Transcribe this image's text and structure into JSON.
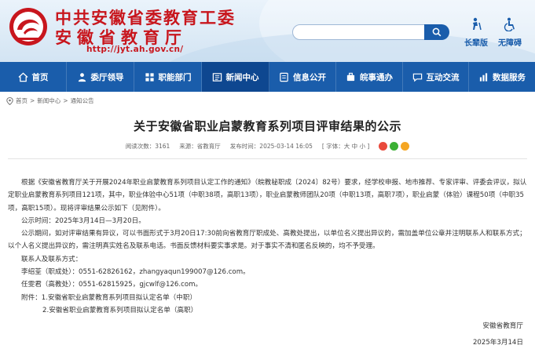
{
  "site": {
    "title_line1": "中共安徽省委教育工委",
    "title_line2": "安徽省教育厅",
    "url": "http://jyt.ah.gov.cn/",
    "tools": [
      {
        "label": "长辈版",
        "icon": "elder-mode-icon"
      },
      {
        "label": "无障碍",
        "icon": "accessibility-icon"
      }
    ]
  },
  "nav": {
    "items": [
      {
        "label": "首页",
        "icon": "home-icon"
      },
      {
        "label": "委厅领导",
        "icon": "leaders-icon"
      },
      {
        "label": "职能部门",
        "icon": "departments-icon"
      },
      {
        "label": "新闻中心",
        "icon": "news-icon",
        "active": true
      },
      {
        "label": "信息公开",
        "icon": "info-icon"
      },
      {
        "label": "皖事通办",
        "icon": "service-icon"
      },
      {
        "label": "互动交流",
        "icon": "chat-icon"
      },
      {
        "label": "数据服务",
        "icon": "data-icon"
      }
    ]
  },
  "breadcrumb": {
    "items": [
      "首页",
      "新闻中心",
      "通知公告"
    ],
    "separator": ">"
  },
  "article": {
    "title": "关于安徽省职业启蒙教育系列项目评审结果的公示",
    "meta": {
      "views": "阅读次数：3161",
      "source": "来源：省教育厅",
      "published": "发布时间：2025-03-14 16:05",
      "font_size": "[ 字体：大 中 小 ]"
    },
    "paragraphs": [
      "根据《安徽省教育厅关于开展2024年职业启蒙教育系列项目认定工作的通知》（皖教秘职成〔2024〕82号）要求，经学校申报、地市推荐、专家评审、评委会评议，拟认定职业启蒙教育系列项目121项，其中，职业体验中心51项（中职38项，高职13项），职业启蒙教师团队20项（中职13项，高职7项），职业启蒙（体验）课程50项（中职35项，高职15项）。现将评审结果公示如下（见附件）。",
      "公示时间：2025年3月14日—3月20日。",
      "公示期间，如对评审结果有异议，可以书面形式于3月20日17:30前向省教育厅职成处、高教处提出，以单位名义提出异议的，需加盖单位公章并注明联系人和联系方式；以个人名义提出异议的，需注明真实姓名及联系电话。书面反馈材料要实事求是。对于事实不清和匿名反映的，均不予受理。",
      "联系人及联系方式：",
      "李绍荃（职成处）：0551-62826162，zhangyaqun199007@126.com。",
      "任雯君（高教处）：0551-62815925，gjcwlf@126.com。"
    ],
    "attachments_label": "附件：",
    "attachments": [
      "1.安徽省职业启蒙教育系列项目拟认定名单（中职）",
      "2.安徽省职业启蒙教育系列项目拟认定名单（高职）"
    ],
    "signature": "安徽省教育厅",
    "date": "2025年3月14日"
  },
  "colors": {
    "brand_red": "#c8161d",
    "nav_blue": "#1a5dab",
    "nav_active": "#0e4790"
  }
}
